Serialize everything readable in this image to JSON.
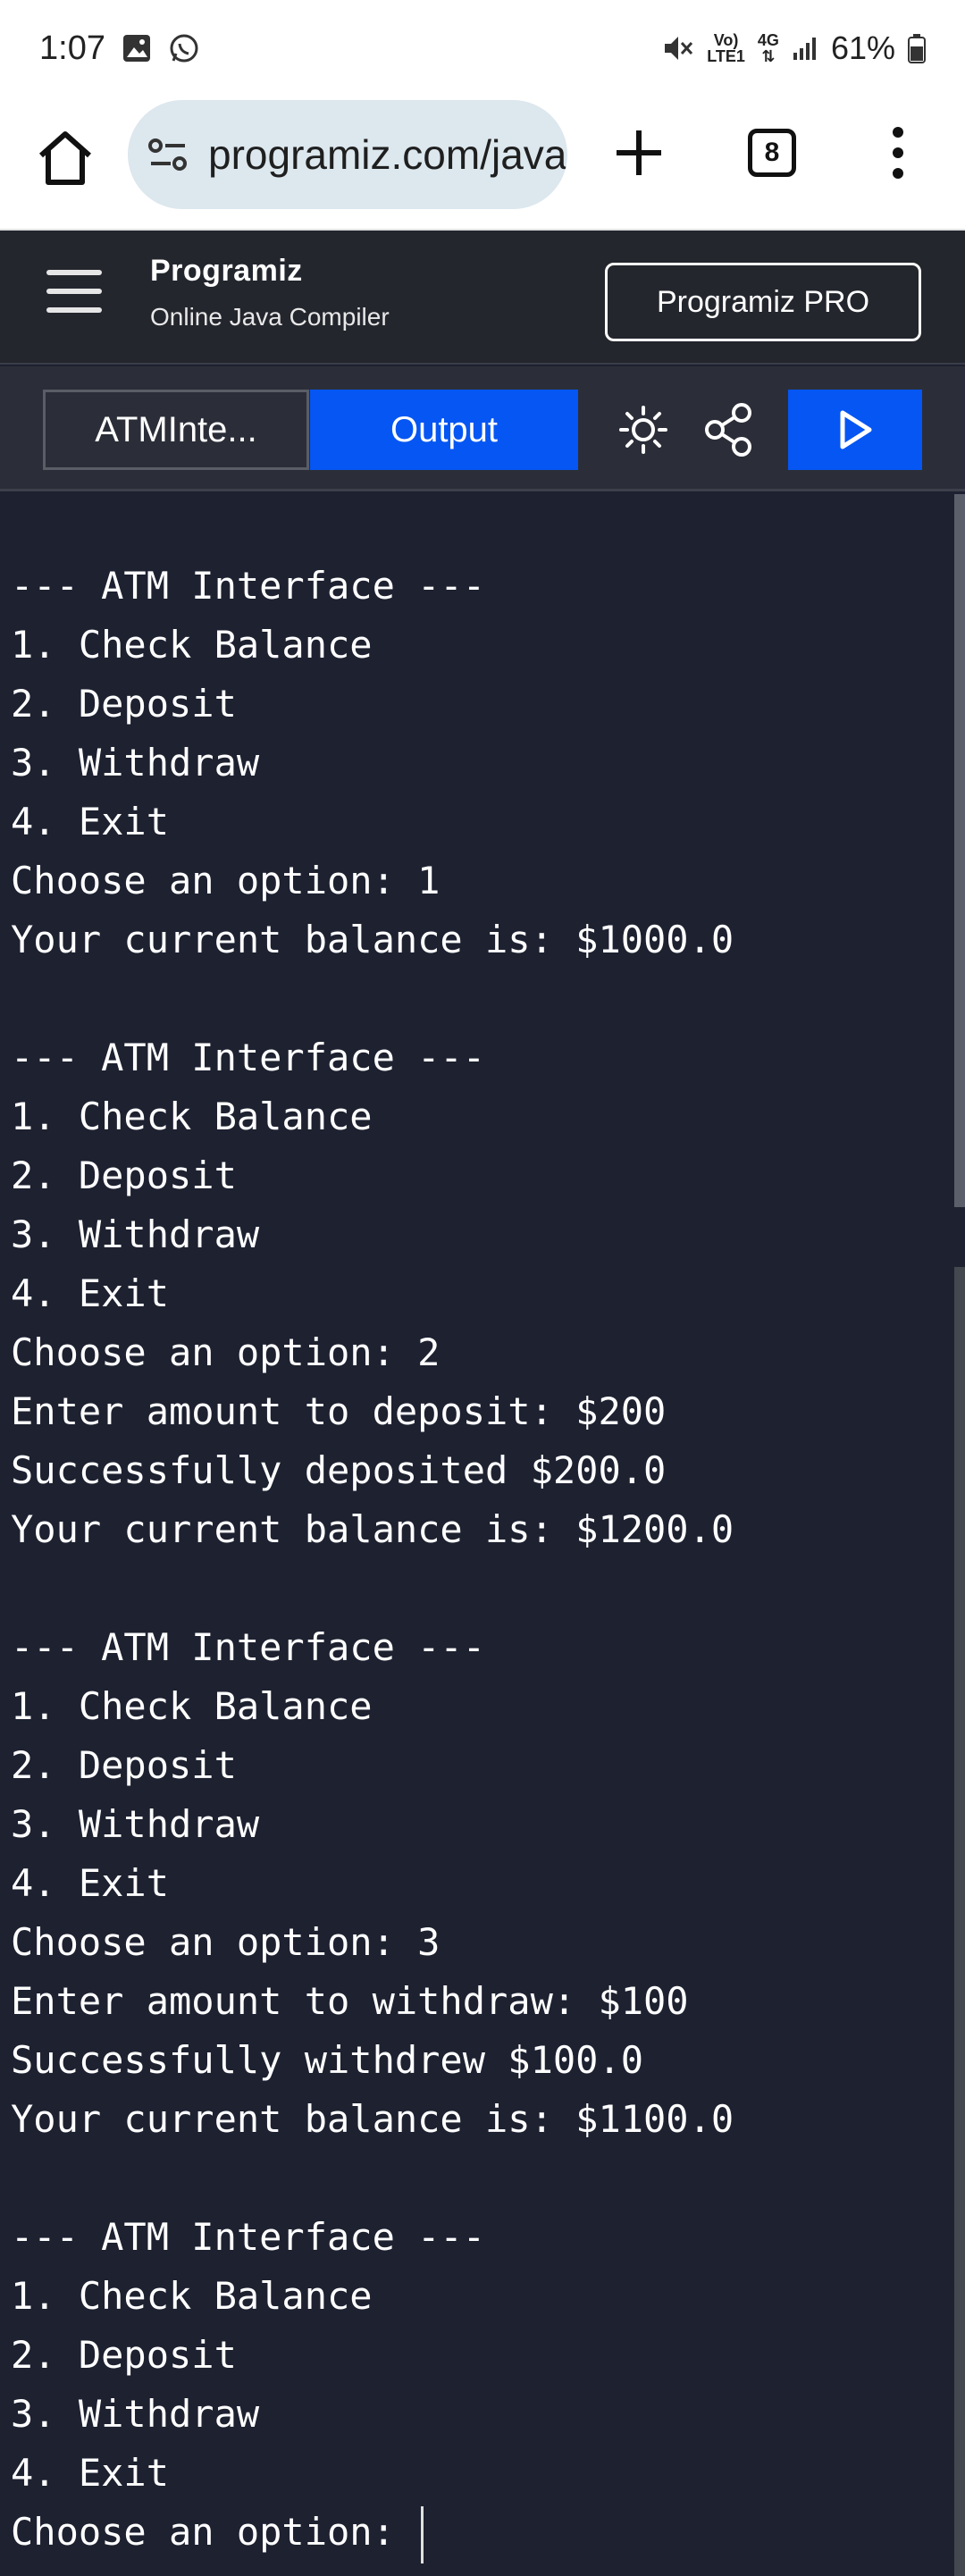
{
  "status_bar": {
    "time": "1:07",
    "network_top": "Vo)",
    "network_bottom": "LTE1",
    "network_type": "4G",
    "battery": "61%"
  },
  "browser": {
    "url": "programiz.com/java",
    "tab_count": "8"
  },
  "header": {
    "brand": "Programiz",
    "subtitle": "Online Java Compiler",
    "pro_label": "Programiz PRO"
  },
  "toolbar": {
    "file_tab": "ATMInte...",
    "output_tab": "Output"
  },
  "console": {
    "lines": [
      "--- ATM Interface ---",
      "1. Check Balance",
      "2. Deposit",
      "3. Withdraw",
      "4. Exit",
      "Choose an option: 1",
      "Your current balance is: $1000.0",
      "",
      "--- ATM Interface ---",
      "1. Check Balance",
      "2. Deposit",
      "3. Withdraw",
      "4. Exit",
      "Choose an option: 2",
      "Enter amount to deposit: $200",
      "Successfully deposited $200.0",
      "Your current balance is: $1200.0",
      "",
      "--- ATM Interface ---",
      "1. Check Balance",
      "2. Deposit",
      "3. Withdraw",
      "4. Exit",
      "Choose an option: 3",
      "Enter amount to withdraw: $100",
      "Successfully withdrew $100.0",
      "Your current balance is: $1100.0",
      "",
      "--- ATM Interface ---",
      "1. Check Balance",
      "2. Deposit",
      "3. Withdraw",
      "4. Exit"
    ],
    "prompt": "Choose an option: "
  }
}
